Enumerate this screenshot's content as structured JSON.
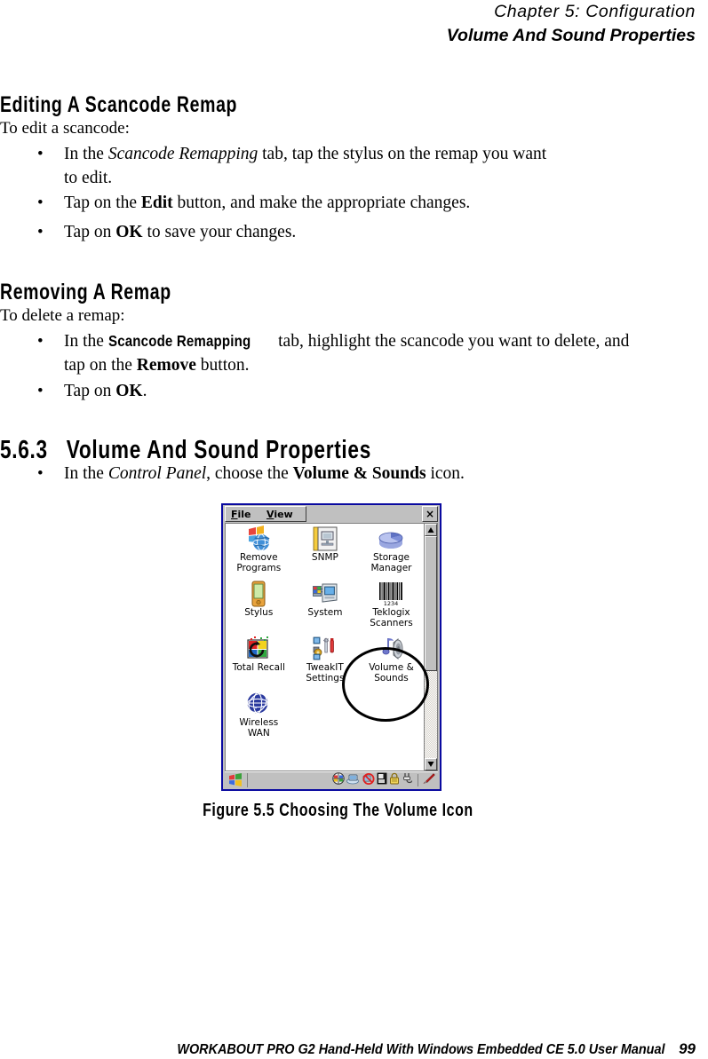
{
  "header": {
    "chapter": "Chapter 5:  Configuration",
    "title": "Volume And Sound Properties"
  },
  "sections": [
    {
      "heading": "Editing A Scancode Remap",
      "lead": "To edit a scancode:",
      "bullets": [
        "In the Scancode Remapping tab, tap the stylus on the remap you want to edit.",
        "Tap on the Edit button, and make the appropriate changes.",
        "Tap on OK to save your changes."
      ]
    },
    {
      "heading": "Removing A Remap",
      "lead": "To delete a remap:",
      "bullets": [
        "In the Scancode Remapping tab, highlight the scancode you want to delete, and tap on the Remove button.",
        "Tap on OK."
      ]
    },
    {
      "number": "5.6.3",
      "heading": "Volume And Sound Properties",
      "bullets": [
        "In the Control Panel, choose the Volume & Sounds icon."
      ]
    }
  ],
  "text_fragments": {
    "bullet_dot": "•",
    "b1_pre": "In the ",
    "b1_ital": "Scancode Remapping",
    "b1_post": " tab, tap the stylus on the remap you want",
    "b1_line2": "to edit.",
    "b2_pre": "Tap on the ",
    "b2_bold": "Edit",
    "b2_post": " button, and make the appropriate changes.",
    "b3_pre": "Tap on ",
    "b3_bold": "OK",
    "b3_post": " to save your changes.",
    "b4_pre": "In the ",
    "b4_cond": "Scancode Remapping",
    "b4_post": " tab, highlight the scancode you want to delete, and",
    "b4_line2_pre": "tap on the ",
    "b4_line2_bold": "Remove",
    "b4_line2_post": " button.",
    "b5_pre": "Tap on ",
    "b5_bold": "OK",
    "b5_post": ".",
    "b6_pre": "In the ",
    "b6_ital": "Control Panel",
    "b6_mid": ", choose the ",
    "b6_bold": "Volume & Sounds",
    "b6_post": " icon."
  },
  "figure": {
    "caption": "Figure 5.5 Choosing The Volume Icon"
  },
  "device_window": {
    "menu": {
      "file_accel": "F",
      "file_rest": "ile",
      "view_accel": "V",
      "view_rest": "iew"
    },
    "close_label": "×",
    "icons": [
      {
        "name": "remove-programs",
        "label": "Remove\nPrograms"
      },
      {
        "name": "snmp",
        "label": "SNMP"
      },
      {
        "name": "storage-manager",
        "label": "Storage\nManager"
      },
      {
        "name": "stylus",
        "label": "Stylus"
      },
      {
        "name": "system",
        "label": "System"
      },
      {
        "name": "teklogix-scanners",
        "label": "Teklogix\nScanners"
      },
      {
        "name": "total-recall",
        "label": "Total Recall"
      },
      {
        "name": "tweakit-settings",
        "label": "TweakIT\nSettings"
      },
      {
        "name": "volume-and-sounds",
        "label": "Volume &\nSounds"
      },
      {
        "name": "wireless-wan",
        "label": "Wireless\nWAN"
      }
    ],
    "barcode_digits": "1234",
    "scrollbar": {
      "up_arrow": "▲",
      "down_arrow": "▼"
    },
    "tray_icons": [
      "network-globe-icon",
      "desktop-icon",
      "no-connection-icon",
      "pc-card-icon",
      "lock-icon",
      "power-plug-icon",
      "stylus-pen-icon"
    ]
  },
  "footer": {
    "text": "WORKABOUT PRO G2 Hand-Held With Windows Embedded CE 5.0 User Manual",
    "page": "99"
  },
  "colors": {
    "window_border": "#0a0aa0",
    "window_face": "#c0c0c0",
    "client_bg": "#ffffff",
    "annotation": "#000000"
  }
}
